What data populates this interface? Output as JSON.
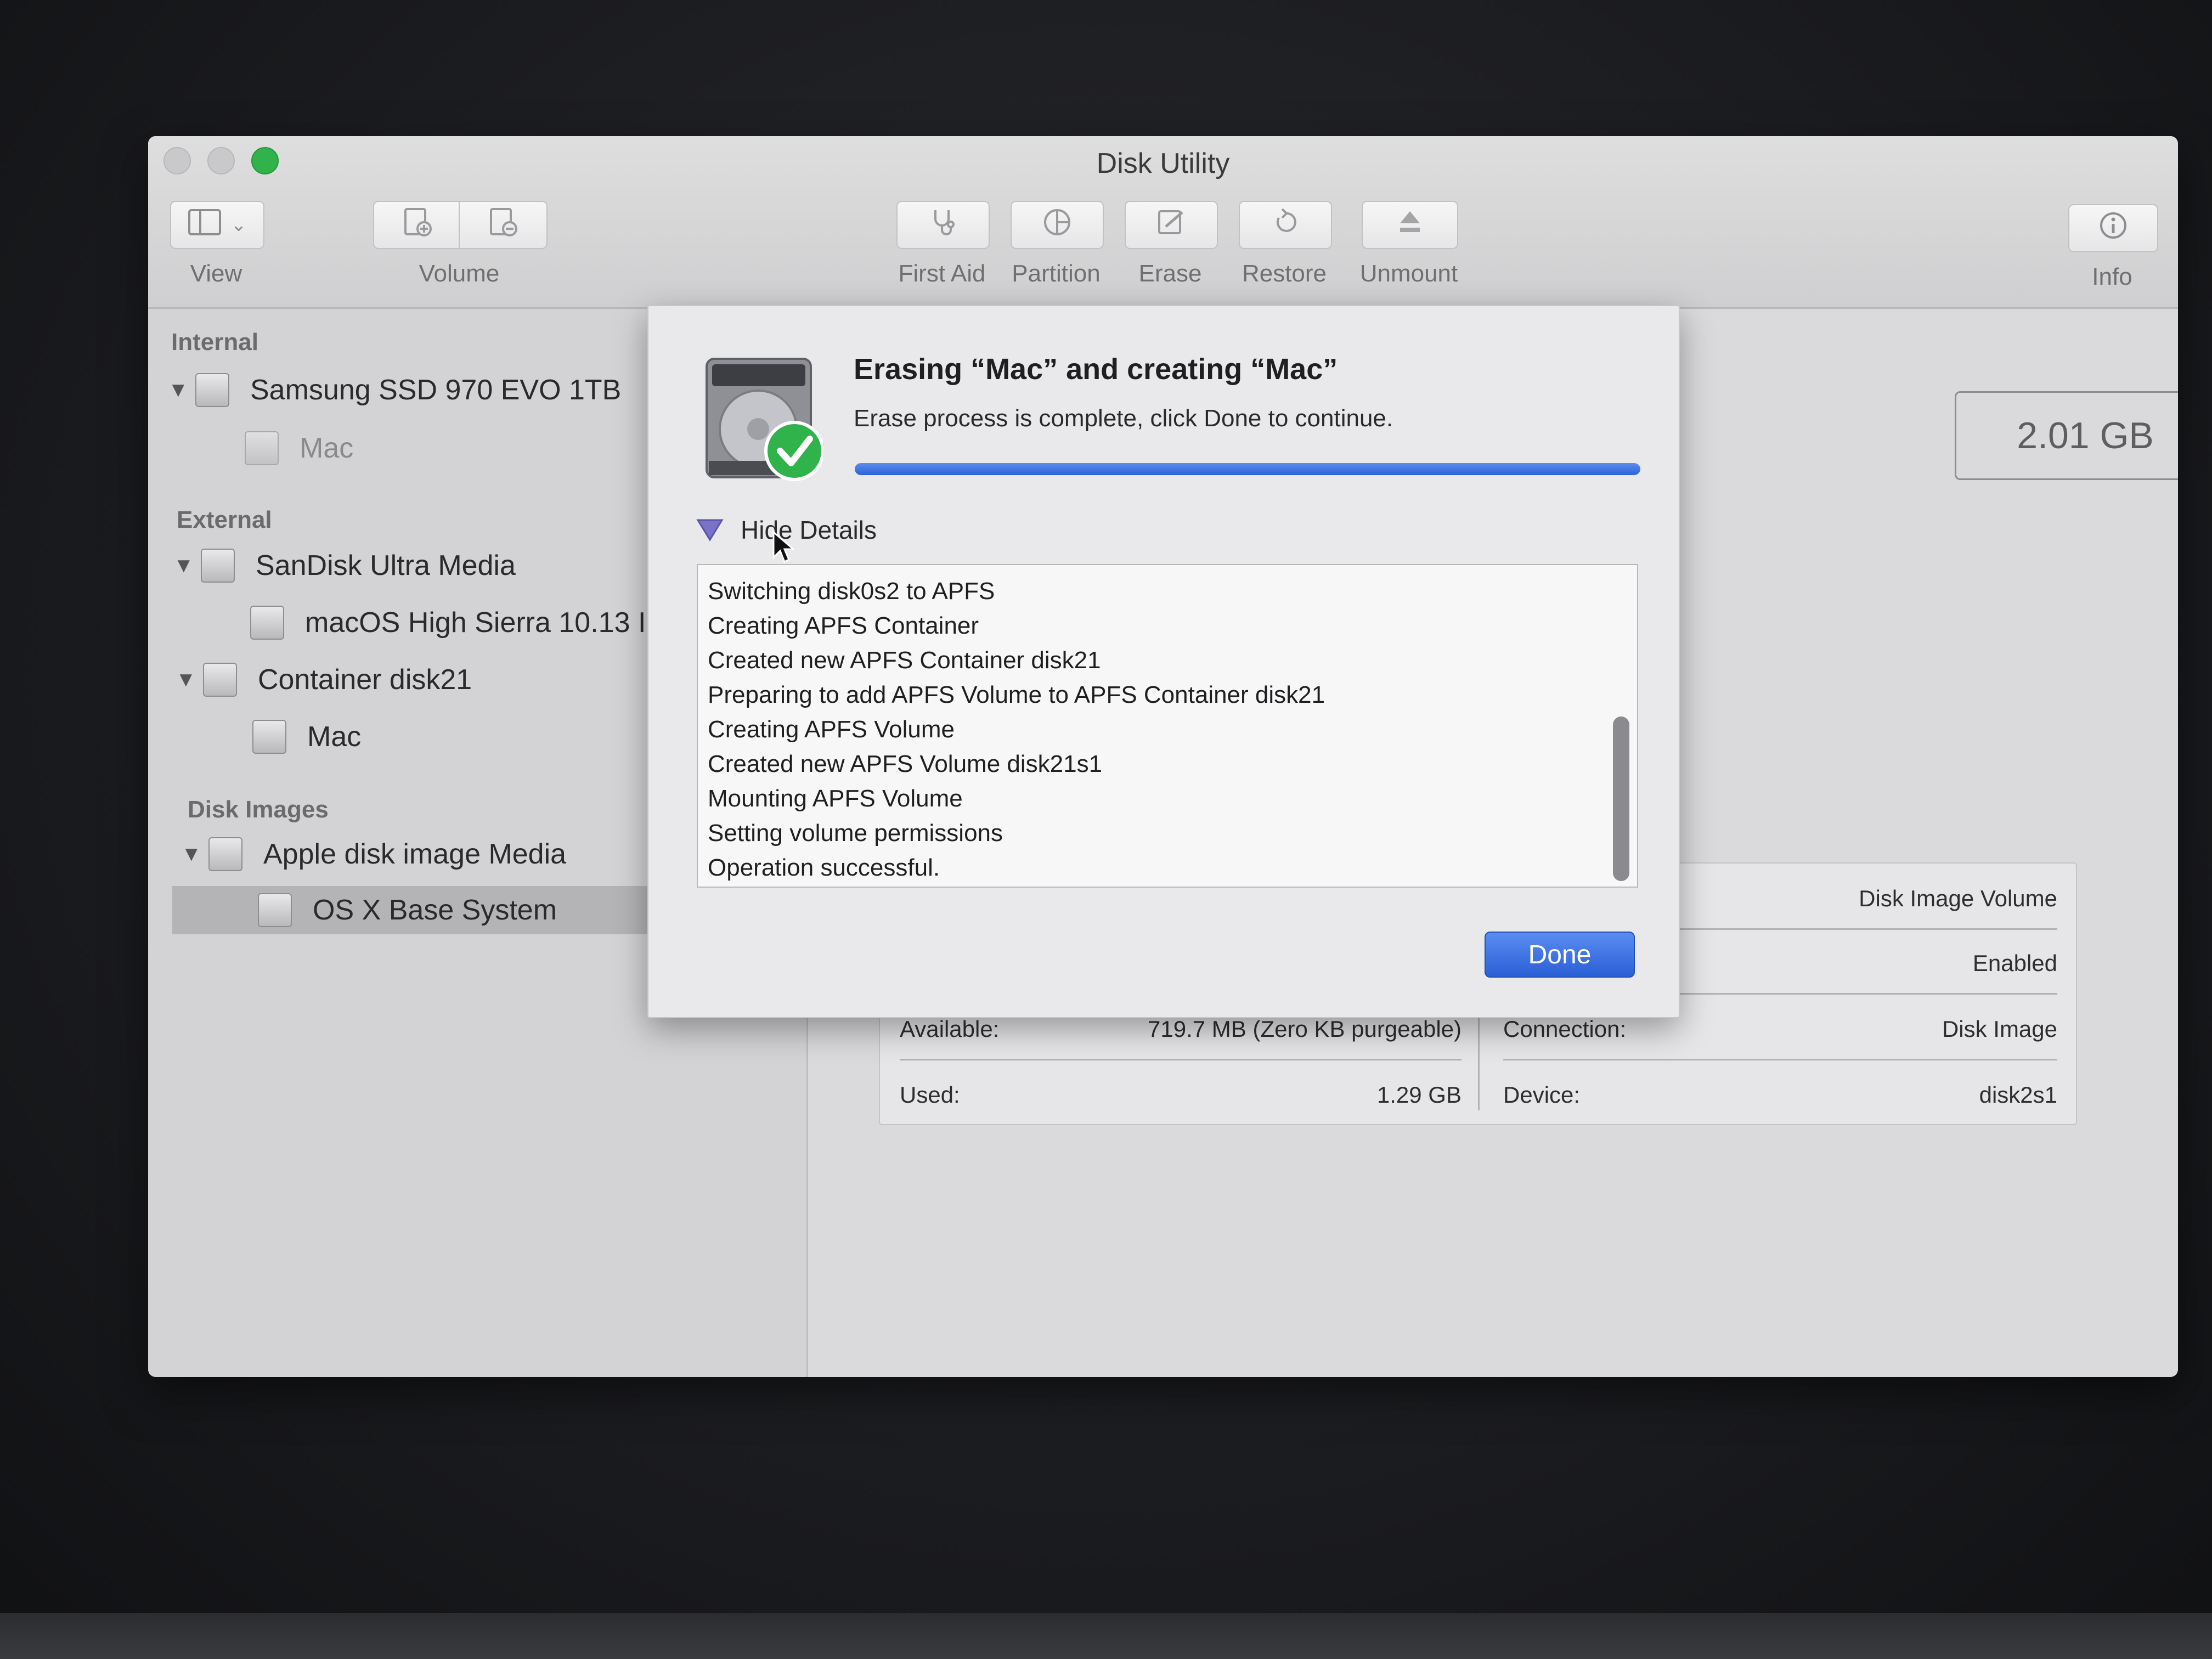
{
  "window": {
    "title": "Disk Utility"
  },
  "toolbar": {
    "view_label": "View",
    "volume_label": "Volume",
    "first_aid_label": "First Aid",
    "partition_label": "Partition",
    "erase_label": "Erase",
    "restore_label": "Restore",
    "unmount_label": "Unmount",
    "info_label": "Info"
  },
  "sidebar": {
    "sections": [
      {
        "title": "Internal",
        "items": [
          {
            "label": "Samsung SSD 970 EVO 1TB",
            "expanded": true
          },
          {
            "label": "Mac"
          }
        ]
      },
      {
        "title": "External",
        "items": [
          {
            "label": "SanDisk Ultra Media",
            "expanded": true
          },
          {
            "label": "macOS High Sierra 10.13 I"
          },
          {
            "label": "Container disk21",
            "expanded": true
          },
          {
            "label": "Mac"
          }
        ]
      },
      {
        "title": "Disk Images",
        "items": [
          {
            "label": "Apple disk image Media",
            "expanded": true
          },
          {
            "label": "OS X Base System",
            "selected": true
          }
        ]
      }
    ]
  },
  "content": {
    "capacity": "2.01 GB",
    "info": {
      "type_value": "Disk Image Volume",
      "owners_value": "Enabled",
      "available_label": "Available:",
      "available_value": "719.7 MB (Zero KB purgeable)",
      "used_label": "Used:",
      "used_value": "1.29 GB",
      "connection_label": "Connection:",
      "connection_value": "Disk Image",
      "device_label": "Device:",
      "device_value": "disk2s1"
    }
  },
  "dialog": {
    "title": "Erasing “Mac” and creating “Mac”",
    "message": "Erase process is complete, click Done to continue.",
    "progress": 1.0,
    "hide_details_label": "Hide Details",
    "log": [
      "Switching disk0s2 to APFS",
      "Creating APFS Container",
      "Created new APFS Container disk21",
      "Preparing to add APFS Volume to APFS Container disk21",
      "Creating APFS Volume",
      "Created new APFS Volume disk21s1",
      "Mounting APFS Volume",
      "Setting volume permissions",
      "Operation successful."
    ],
    "done_label": "Done"
  },
  "colors": {
    "accent": "#2d62d8",
    "success_green": "#2fb34a"
  }
}
